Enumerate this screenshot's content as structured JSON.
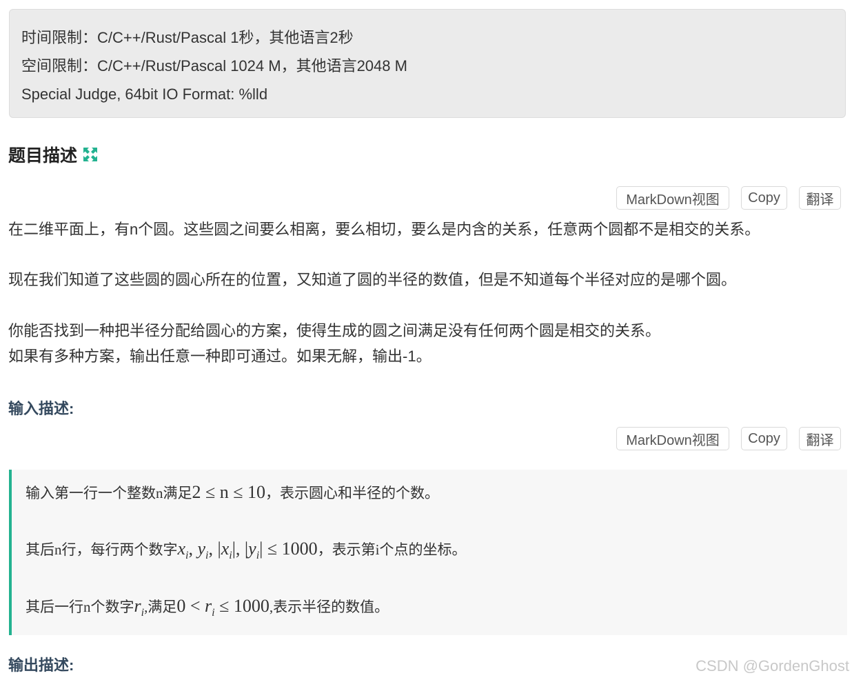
{
  "limits": {
    "time": "时间限制：C/C++/Rust/Pascal 1秒，其他语言2秒",
    "space": "空间限制：C/C++/Rust/Pascal 1024 M，其他语言2048 M",
    "judge": "Special Judge, 64bit IO Format: %lld"
  },
  "section": {
    "title": "题目描述",
    "icon": "expand-arrows-icon",
    "accent": "#23b290"
  },
  "buttons": {
    "markdown": "MarkDown视图",
    "copy": "Copy",
    "translate": "翻译"
  },
  "description": {
    "p1": "在二维平面上，有n个圆。这些圆之间要么相离，要么相切，要么是内含的关系，任意两个圆都不是相交的关系。",
    "p2": "现在我们知道了这些圆的圆心所在的位置，又知道了圆的半径的数值，但是不知道每个半径对应的是哪个圆。",
    "p3": "你能否找到一种把半径分配给圆心的方案，使得生成的圆之间满足没有任何两个圆是相交的关系。",
    "p4": "如果有多种方案，输出任意一种即可通过。如果无解，输出-1。"
  },
  "input_section": {
    "title": "输入描述:",
    "line1_prefix": "输入第一行一个整数n满足",
    "line1_math": "2 ≤ n ≤ 10",
    "line1_suffix": "，表示圆心和半径的个数。",
    "line2_prefix": "其后n行，每行两个数字",
    "line2_suffix": "，表示第i个点的坐标。",
    "line3_prefix": "其后一行n个数字",
    "line3_mid": ",满足",
    "line3_suffix": ",表示半径的数值。"
  },
  "output_section": {
    "title": "输出描述:"
  },
  "watermark": "CSDN @GordenGhost"
}
